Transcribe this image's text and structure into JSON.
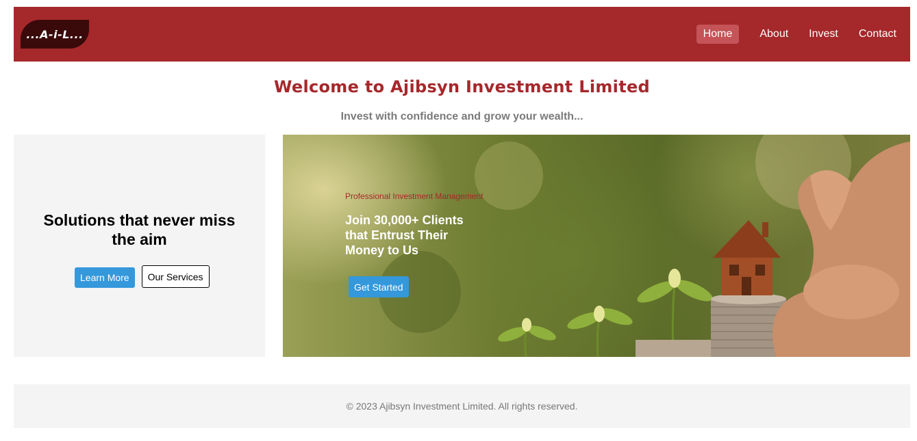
{
  "nav": {
    "logo_text": "...A-i-L...",
    "links": [
      {
        "label": "Home",
        "active": true
      },
      {
        "label": "About",
        "active": false
      },
      {
        "label": "Invest",
        "active": false
      },
      {
        "label": "Contact",
        "active": false
      }
    ]
  },
  "header": {
    "title": "Welcome to Ajibsyn Investment Limited",
    "tagline": "Invest with confidence and grow your wealth..."
  },
  "intro": {
    "title": "Solutions that never miss the aim",
    "learn_more": "Learn More",
    "our_services": "Our Services"
  },
  "hero": {
    "subtitle": "Professional Investment Management",
    "title": "Join 30,000+ Clients that Entrust Their Money to Us",
    "cta": "Get Started",
    "image_icon": "house-on-coins-image"
  },
  "footer": {
    "text": "© 2023 Ajibsyn Investment Limited. All rights reserved."
  },
  "colors": {
    "brand": "#a5282b",
    "accent": "#3498db",
    "panel": "#f4f4f4"
  }
}
